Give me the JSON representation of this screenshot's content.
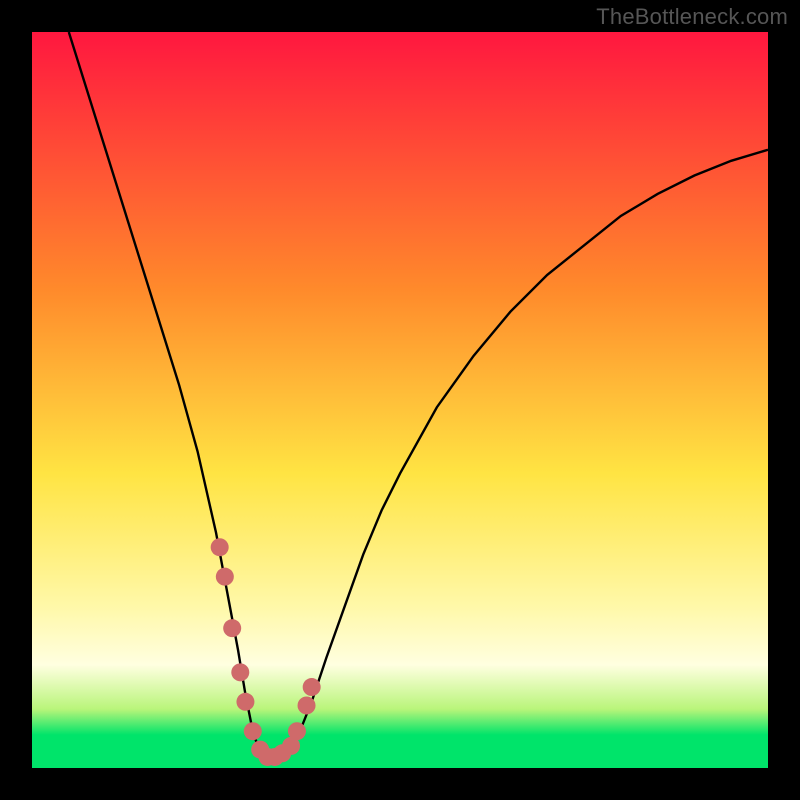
{
  "watermark": {
    "text": "TheBottleneck.com"
  },
  "colors": {
    "frame": "#000000",
    "curve": "#000000",
    "markers": "#cf6a6a",
    "green": "#00e46a",
    "gradient_top": "#ff173f",
    "gradient_mid1": "#ff8a2b",
    "gradient_mid2": "#ffe443",
    "gradient_soft": "#fff8a8",
    "gradient_low": "#b9f57a"
  },
  "chart_data": {
    "type": "line",
    "title": "",
    "xlabel": "",
    "ylabel": "",
    "xlim": [
      0,
      100
    ],
    "ylim": [
      0,
      100
    ],
    "x": [
      5,
      7.5,
      10,
      12.5,
      15,
      17.5,
      20,
      22.5,
      25,
      26.5,
      28,
      29,
      30,
      31,
      32,
      33,
      34,
      35,
      36,
      38,
      40,
      42.5,
      45,
      47.5,
      50,
      55,
      60,
      65,
      70,
      75,
      80,
      85,
      90,
      95,
      100
    ],
    "values": [
      100,
      92,
      84,
      76,
      68,
      60,
      52,
      43,
      32,
      24,
      16,
      10,
      5,
      2,
      1,
      1,
      1,
      2,
      4,
      9,
      15,
      22,
      29,
      35,
      40,
      49,
      56,
      62,
      67,
      71,
      75,
      78,
      80.5,
      82.5,
      84
    ],
    "markers_x": [
      25.5,
      26.2,
      27.2,
      28.3,
      29.0,
      30.0,
      31.0,
      32.0,
      33.0,
      34.0,
      35.2,
      36.0,
      37.3,
      38.0
    ],
    "markers_y": [
      30,
      26,
      19,
      13,
      9,
      5,
      2.5,
      1.5,
      1.5,
      2.0,
      3.0,
      5,
      8.5,
      11
    ],
    "gradient_stops": [
      {
        "offset": 0.0,
        "color": "#ff173f"
      },
      {
        "offset": 0.35,
        "color": "#ff8a2b"
      },
      {
        "offset": 0.6,
        "color": "#ffe443"
      },
      {
        "offset": 0.78,
        "color": "#fff8a8"
      },
      {
        "offset": 0.86,
        "color": "#ffffe0"
      },
      {
        "offset": 0.92,
        "color": "#b9f57a"
      },
      {
        "offset": 0.955,
        "color": "#00e46a"
      },
      {
        "offset": 1.0,
        "color": "#00e46a"
      }
    ]
  }
}
